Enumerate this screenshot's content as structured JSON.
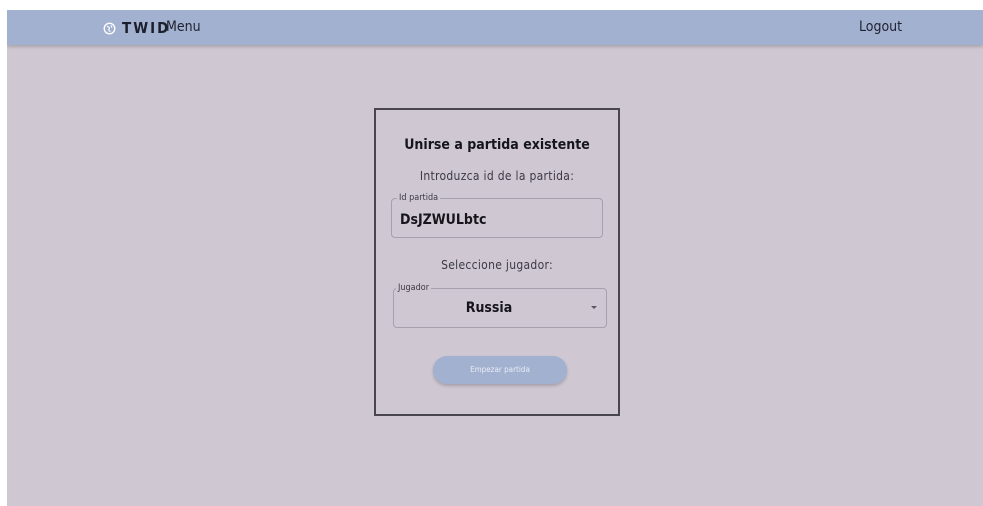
{
  "navbar": {
    "brand_icon": "globe-icon",
    "brand_name": "TWID",
    "menu_label": "Menu",
    "logout_label": "Logout"
  },
  "card": {
    "title": "Unirse a partida existente",
    "id_prompt": "Introduzca id de la partida:",
    "id_field": {
      "label": "Id partida",
      "value": "DsJZWULbtc"
    },
    "player_prompt": "Seleccione jugador:",
    "player_select": {
      "label": "Jugador",
      "selected": "Russia",
      "arrow_icon": "chevron-down-icon"
    },
    "start_button": "Empezar partida"
  },
  "colors": {
    "navbar_bg": "#a3b1d1",
    "page_bg": "#cfc8d2",
    "card_border": "#4a4650",
    "button_bg": "#a3b1d1"
  }
}
